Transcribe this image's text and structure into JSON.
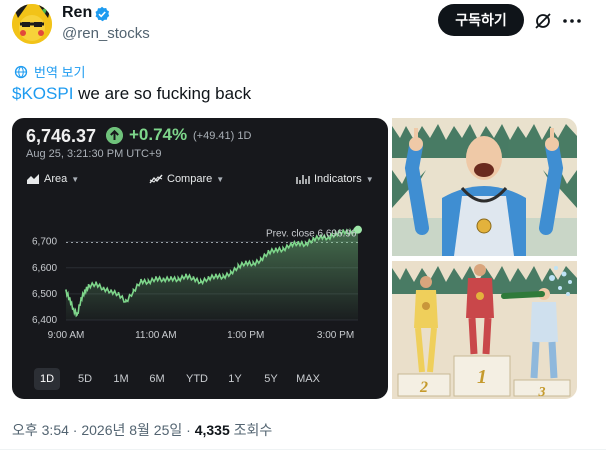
{
  "author": {
    "display_name": "Ren",
    "handle": "@ren_stocks"
  },
  "actions": {
    "subscribe_label": "구독하기",
    "grok_icon": "grok-slash-icon",
    "more_icon": "more-dots-icon"
  },
  "translate_label": "번역 보기",
  "tweet": {
    "cashtag": "$KOSPI",
    "text": " we are so fucking back"
  },
  "stock_card": {
    "price": "6,746.37",
    "change_pct": "+0.74%",
    "change_abs": "(+49.41) 1D",
    "timestamp": "Aug 25, 3:21:30 PM UTC+9",
    "toolbar": {
      "area_label": "Area",
      "compare_label": "Compare",
      "indicators_label": "Indicators"
    },
    "prev_close_label": "Prev. close",
    "prev_close_value": "6,696.96",
    "ranges": [
      "1D",
      "5D",
      "1M",
      "6M",
      "YTD",
      "1Y",
      "5Y",
      "MAX"
    ],
    "active_range": "1D",
    "colors": {
      "up": "#7ed68b",
      "line": "#7ed68b",
      "background": "#17181c"
    }
  },
  "chart_data": {
    "type": "area",
    "title": "",
    "xlabel": "",
    "ylabel": "",
    "x_ticks": [
      "9:00 AM",
      "11:00 AM",
      "1:00 PM",
      "3:00 PM"
    ],
    "y_ticks": [
      6400,
      6500,
      6600,
      6700
    ],
    "ylim": [
      6400,
      6760
    ],
    "xlim": [
      "9:00",
      "15:30"
    ],
    "reference_line": {
      "label": "Prev. close",
      "value": 6696.96
    },
    "series": [
      {
        "x": [
          "9:00",
          "9:05",
          "9:10",
          "9:15",
          "9:20",
          "9:25",
          "9:30",
          "9:40",
          "9:50",
          "10:00",
          "10:10",
          "10:20",
          "10:30",
          "10:40",
          "10:50",
          "11:00",
          "11:10",
          "11:20",
          "11:30",
          "11:40",
          "11:50",
          "12:00",
          "12:10",
          "12:20",
          "12:30",
          "12:40",
          "12:50",
          "13:00",
          "13:10",
          "13:20",
          "13:30",
          "13:40",
          "13:50",
          "14:00",
          "14:10",
          "14:20",
          "14:30",
          "14:40",
          "14:50",
          "15:00",
          "15:10",
          "15:20",
          "15:30"
        ],
        "y": [
          6510,
          6480,
          6440,
          6420,
          6480,
          6510,
          6530,
          6540,
          6520,
          6510,
          6500,
          6470,
          6510,
          6550,
          6545,
          6560,
          6555,
          6560,
          6555,
          6570,
          6560,
          6545,
          6560,
          6570,
          6565,
          6580,
          6605,
          6620,
          6615,
          6630,
          6660,
          6670,
          6670,
          6690,
          6695,
          6690,
          6710,
          6720,
          6715,
          6730,
          6740,
          6735,
          6746
        ]
      }
    ]
  },
  "meme": {
    "podium_labels": [
      "2",
      "1",
      "3"
    ]
  },
  "footer": {
    "time_date": "오후 3:54 · 2026년 8월 25일 · ",
    "views_count": "4,335",
    "views_label": " 조회수"
  }
}
